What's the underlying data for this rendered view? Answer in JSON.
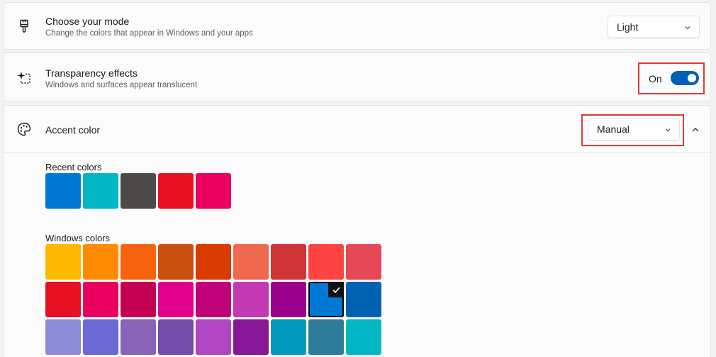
{
  "mode": {
    "title": "Choose your mode",
    "description": "Change the colors that appear in Windows and your apps",
    "selected": "Light",
    "icon": "paintbrush-icon"
  },
  "transparency": {
    "title": "Transparency effects",
    "description": "Windows and surfaces appear translucent",
    "state_label": "On",
    "is_on": true,
    "icon": "sparkle-icon"
  },
  "accent": {
    "title": "Accent color",
    "selected": "Manual",
    "icon": "palette-icon",
    "expanded": true,
    "recent_label": "Recent colors",
    "recent_colors": [
      "#0078d4",
      "#00b7c3",
      "#4c4a48",
      "#e81123",
      "#ea005e"
    ],
    "windows_label": "Windows colors",
    "windows_colors": [
      [
        "#ffb900",
        "#ff8c00",
        "#f7630c",
        "#ca5010",
        "#da3b01",
        "#ef6950",
        "#d13438",
        "#ff4343",
        "#e74856"
      ],
      [
        "#e81123",
        "#ea005e",
        "#c30052",
        "#e3008c",
        "#bf0077",
        "#c239b3",
        "#9a0089",
        "#0078d4",
        "#0063b1"
      ],
      [
        "#8e8cd8",
        "#6b69d6",
        "#8764b8",
        "#744da9",
        "#b146c2",
        "#881798",
        "#0099bc",
        "#2d7d9a",
        "#00b7c3"
      ]
    ],
    "selected_swatch": {
      "row": 1,
      "col": 7
    }
  },
  "colors": {
    "toggle_on": "#005fb8",
    "highlight_border": "#d93b3b",
    "card_bg": "#fbfbfb",
    "page_bg": "#f3f3f3"
  }
}
